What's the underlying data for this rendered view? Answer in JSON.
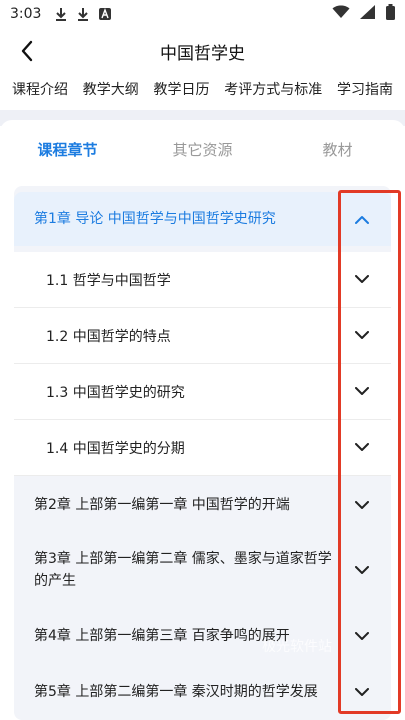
{
  "status_bar": {
    "time": "3:03",
    "icons": [
      "download-icon",
      "download-icon",
      "a-box-icon"
    ],
    "right_icons": [
      "wifi-icon",
      "signal-icon",
      "battery-icon"
    ]
  },
  "header": {
    "title": "中国哲学史",
    "back_icon": "back-arrow-icon"
  },
  "top_tabs": [
    "课程介绍",
    "教学大纲",
    "教学日历",
    "考评方式与标准",
    "学习指南"
  ],
  "sub_tabs": [
    {
      "label": "课程章节",
      "active": true
    },
    {
      "label": "其它资源",
      "active": false
    },
    {
      "label": "教材",
      "active": false
    }
  ],
  "chapters": [
    {
      "label": "第1章 导论 中国哲学与中国哲学史研究",
      "expanded": true
    },
    {
      "label": "第2章 上部第一编第一章 中国哲学的开端",
      "expanded": false
    },
    {
      "label": "第3章 上部第一编第二章 儒家、墨家与道家哲学的产生",
      "expanded": false
    },
    {
      "label": "第4章 上部第一编第三章 百家争鸣的展开",
      "expanded": false
    },
    {
      "label": "第5章 上部第二编第一章 秦汉时期的哲学发展",
      "expanded": false
    }
  ],
  "sections": [
    "1.1 哲学与中国哲学",
    "1.2 中国哲学的特点",
    "1.3 中国哲学史的研究",
    "1.4 中国哲学史的分期"
  ],
  "watermark": "极光软件站",
  "colors": {
    "accent": "#1c7ce0",
    "highlight": "#e23a26",
    "list_bg": "#f2f4f9"
  }
}
